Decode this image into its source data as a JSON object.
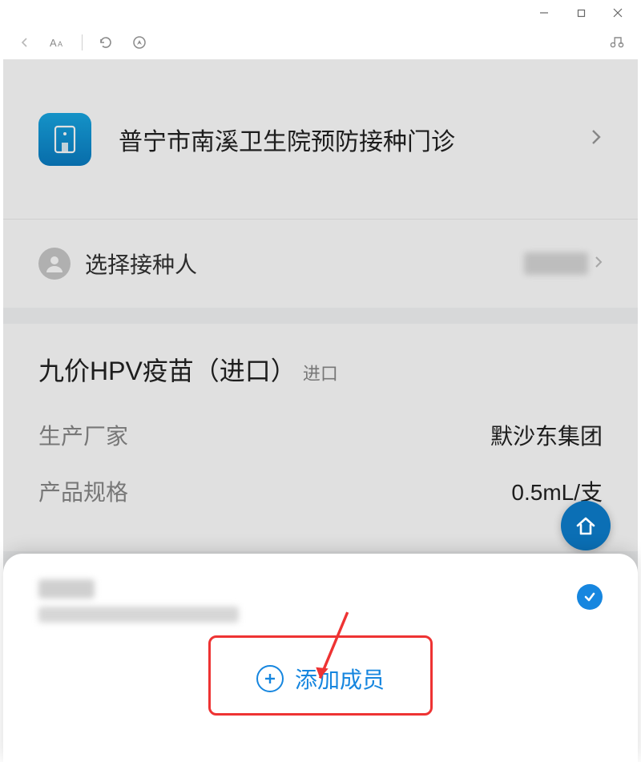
{
  "clinic": {
    "name": "普宁市南溪卫生院预防接种门诊"
  },
  "person": {
    "label": "选择接种人"
  },
  "vaccine": {
    "name": "九价HPV疫苗（进口）",
    "tag": "进口",
    "manufacturer_label": "生产厂家",
    "manufacturer_value": "默沙东集团",
    "spec_label": "产品规格",
    "spec_value": "0.5mL/支"
  },
  "sheet": {
    "add_member_label": "添加成员"
  }
}
